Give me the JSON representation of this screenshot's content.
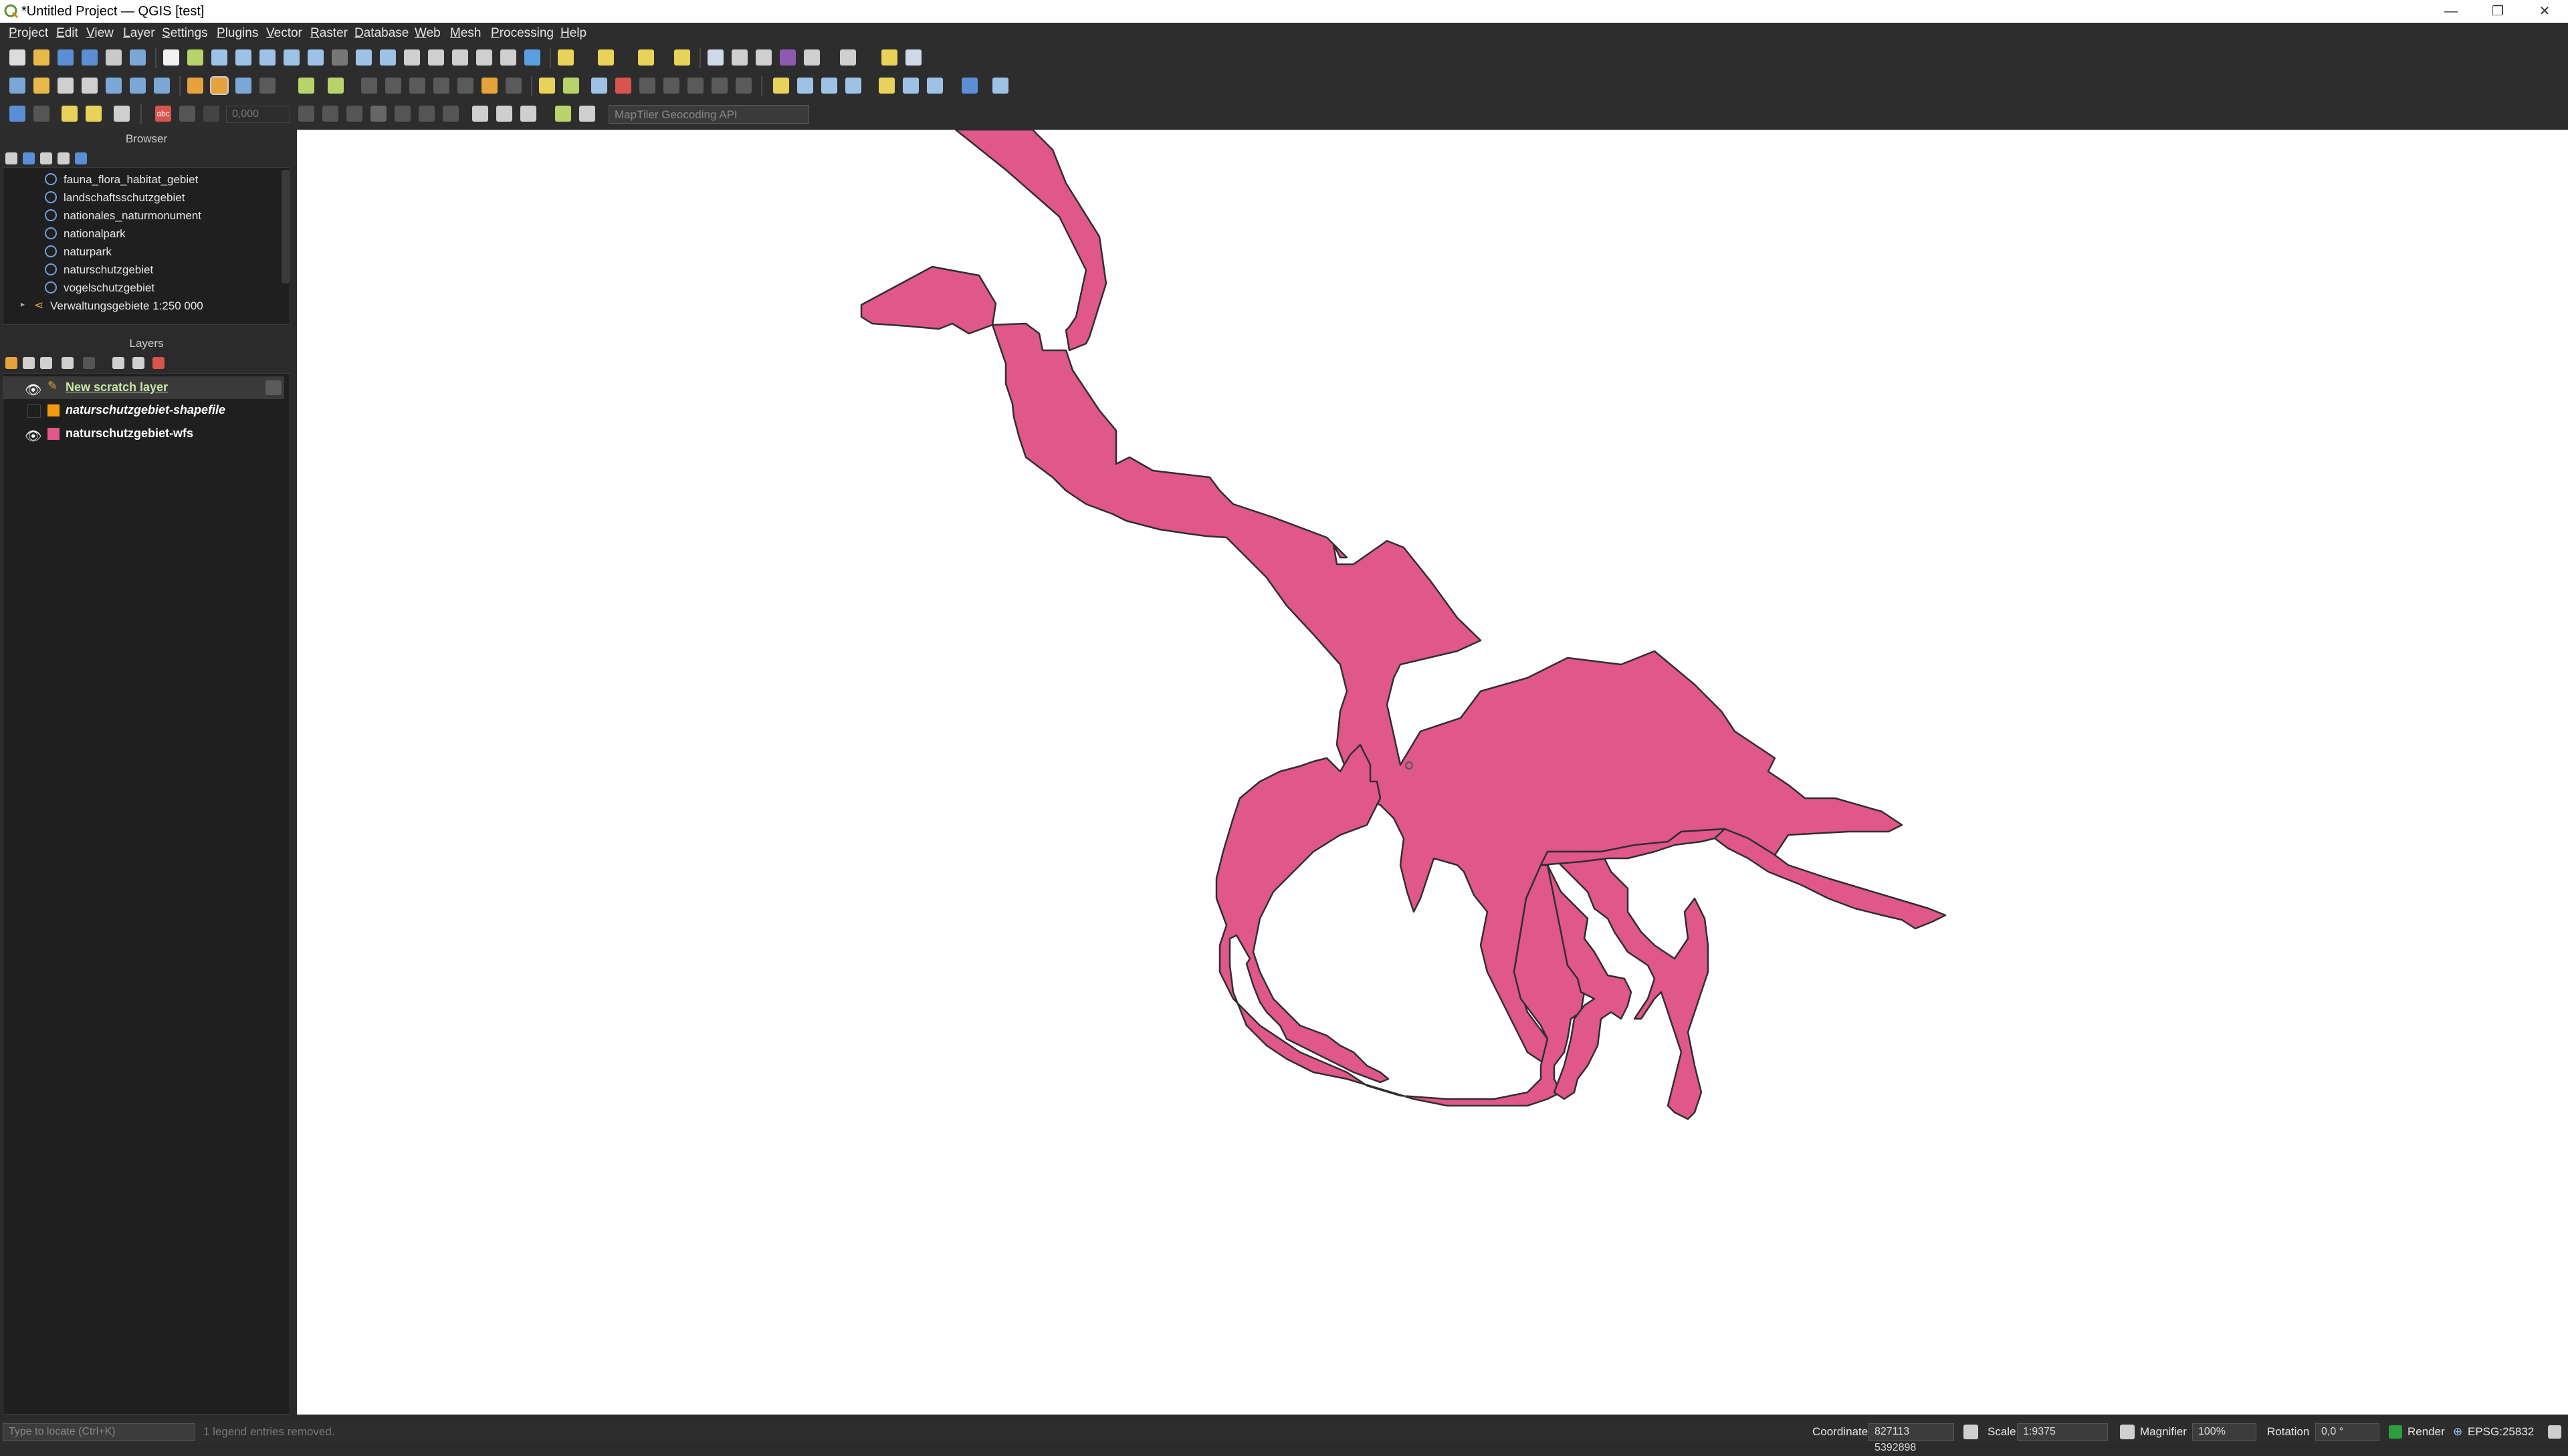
{
  "window": {
    "title": "*Untitled Project — QGIS [test]",
    "controls": [
      "—",
      "❐",
      "✕"
    ]
  },
  "menu": [
    "Project",
    "Edit",
    "View",
    "Layer",
    "Settings",
    "Plugins",
    "Vector",
    "Raster",
    "Database",
    "Web",
    "Mesh",
    "Processing",
    "Help"
  ],
  "toolbar": {
    "geocoder_placeholder": "MapTiler Geocoding API",
    "label_settings": "abc",
    "offset_value": "0,000"
  },
  "browser": {
    "title": "Browser",
    "items": [
      "fauna_flora_habitat_gebiet",
      "landschaftsschutzgebiet",
      "nationales_naturmonument",
      "nationalpark",
      "naturpark",
      "naturschutzgebiet",
      "vogelschutzgebiet"
    ],
    "group": "Verwaltungsgebiete 1:250 000"
  },
  "layers": {
    "title": "Layers",
    "items": [
      {
        "name": "New scratch layer",
        "visible": true,
        "editing": true,
        "color": "#c5e8a8"
      },
      {
        "name": "naturschutzgebiet-shapefile",
        "visible": false,
        "editing": false,
        "color": "#f39c12"
      },
      {
        "name": "naturschutzgebiet-wfs",
        "visible": true,
        "editing": false,
        "color": "#e0578a"
      }
    ]
  },
  "map": {
    "feature_color": "#e0578a",
    "outline_color": "#2f2f2f",
    "background": "#ffffff"
  },
  "status": {
    "locator_placeholder": "Type to locate (Ctrl+K)",
    "message": "1 legend entries removed.",
    "coordinate_label": "Coordinate",
    "coordinate_value": "827113 5392898",
    "scale_label": "Scale",
    "scale_value": "1:9375",
    "magnifier_label": "Magnifier",
    "magnifier_value": "100%",
    "rotation_label": "Rotation",
    "rotation_value": "0,0 °",
    "render_label": "Render",
    "crs": "EPSG:25832"
  }
}
